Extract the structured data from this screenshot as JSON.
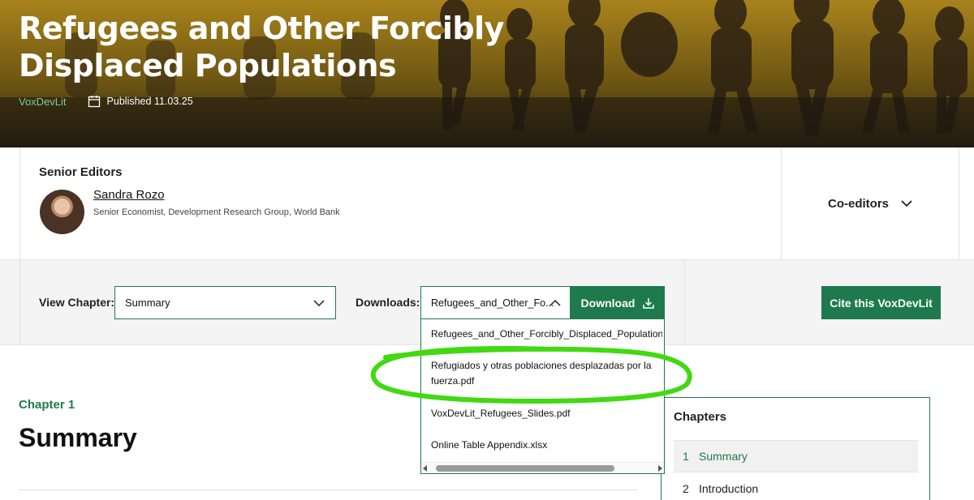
{
  "hero": {
    "title": "Refugees and Other Forcibly Displaced Populations",
    "brand": "VoxDevLit",
    "published": "Published 11.03.25"
  },
  "editors": {
    "heading": "Senior Editors",
    "name": "Sandra Rozo",
    "role": "Senior Economist, Development Research Group, World Bank",
    "coeditors_label": "Co-editors"
  },
  "toolbar": {
    "view_label": "View Chapter:",
    "chapter_value": "Summary",
    "downloads_label": "Downloads:",
    "download_value": "Refugees_and_Other_Fo...",
    "download_button": "Download",
    "cite_button": "Cite this VoxDevLit"
  },
  "downloads_list": [
    "Refugees_and_Other_Forcibly_Displaced_Populations_Eng.pdf",
    "Refugiados y otras poblaciones desplazadas por la fuerza.pdf",
    "VoxDevLit_Refugees_Slides.pdf",
    "Online Table Appendix.xlsx"
  ],
  "main": {
    "kicker": "Chapter 1",
    "title": "Summary"
  },
  "chapters": {
    "heading": "Chapters",
    "items": [
      {
        "num": "1",
        "label": "Summary"
      },
      {
        "num": "2",
        "label": "Introduction"
      }
    ]
  },
  "colors": {
    "brand_green": "#1e7a4c",
    "annotation": "#41d912"
  }
}
